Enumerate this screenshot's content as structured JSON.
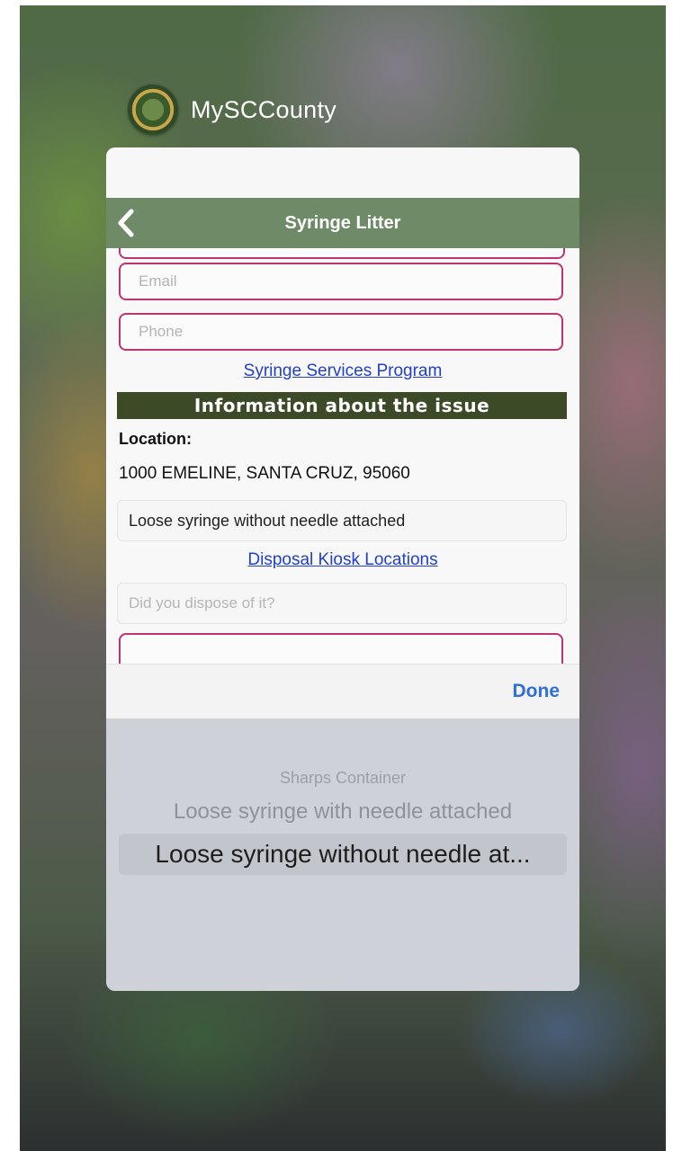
{
  "app": {
    "name": "MySCCounty",
    "icon": "county-seal-icon"
  },
  "navbar": {
    "title": "Syringe Litter",
    "back_icon": "chevron-left-icon",
    "color": "#6e8a66"
  },
  "form": {
    "email_placeholder": "Email",
    "phone_placeholder": "Phone",
    "services_link": "Syringe Services Program",
    "section_title": "Information about the issue",
    "location_label": "Location:",
    "location_value": "1000 EMELINE, SANTA CRUZ, 95060",
    "syringe_type_value": "Loose syringe without needle attached",
    "kiosk_link": "Disposal Kiosk Locations",
    "dispose_placeholder": "Did you dispose of it?"
  },
  "picker": {
    "done_label": "Done",
    "options": [
      "Sharps Container",
      "Loose syringe with needle attached",
      "Loose syringe without needle at..."
    ],
    "selected_index": 2
  },
  "colors": {
    "field_border": "#c0336f",
    "link": "#2340c8",
    "section_bar": "#3d4a28",
    "done": "#2f6fd6"
  }
}
